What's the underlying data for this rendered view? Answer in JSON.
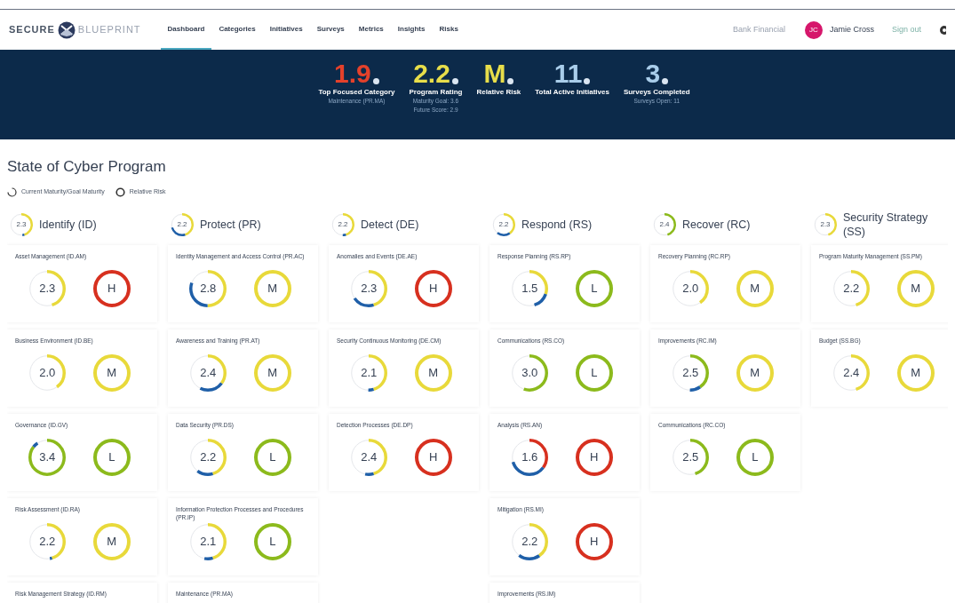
{
  "brand": {
    "left": "SECURE",
    "right": "BLUEPRINT"
  },
  "nav": [
    {
      "label": "Dashboard",
      "selected": true
    },
    {
      "label": "Categories",
      "selected": false
    },
    {
      "label": "Initiatives",
      "selected": false
    },
    {
      "label": "Surveys",
      "selected": false
    },
    {
      "label": "Metrics",
      "selected": false
    },
    {
      "label": "Insights",
      "selected": false
    },
    {
      "label": "Risks",
      "selected": false
    }
  ],
  "user": {
    "organization": "Bank Financial",
    "initials": "JC",
    "name": "Jamie Cross",
    "sign_out": "Sign out"
  },
  "stats": [
    {
      "value": "1.9",
      "color": "#e4412b",
      "label": "Top Focused Category",
      "notes": [
        "Maintenance (PR.MA)"
      ]
    },
    {
      "value": "2.2",
      "color": "#e8de4a",
      "label": "Program Rating",
      "notes": [
        "Maturity Goal: 3.6",
        "Future Score: 2.9"
      ]
    },
    {
      "value": "M",
      "color": "#e8de4a",
      "label": "Relative Risk"
    },
    {
      "value": "11",
      "color": "#a9cdea",
      "label": "Total Active Initiatives"
    },
    {
      "value": "3",
      "color": "#a9cdea",
      "label": "Surveys Completed",
      "notes": [
        "Surveys Open: 11"
      ]
    }
  ],
  "title": "State of Cyber Program",
  "legend": [
    "Current Maturity/Goal Maturity",
    "Relative Risk"
  ],
  "columns": [
    {
      "title": "Identify (ID)",
      "maturity": {
        "score": "2.3",
        "color": "#e8d93a",
        "level": 0.45,
        "future": {
          "level": 0.03
        }
      },
      "cards": [
        {
          "title": "Asset Management (ID.AM)",
          "maturity": {
            "score": "2.3",
            "color": "#e8d93a",
            "level": 0.45
          },
          "risk": {
            "label": "H",
            "color": "#d7301f"
          }
        },
        {
          "title": "Business Environment (ID.BE)",
          "maturity": {
            "score": "2.0",
            "color": "#e8d93a",
            "level": 0.4
          },
          "risk": {
            "label": "M",
            "color": "#e8d93a"
          }
        },
        {
          "title": "Governance (ID.GV)",
          "maturity": {
            "score": "3.4",
            "color": "#8cba1c",
            "level": 0.85,
            "future": {
              "level": 0.05
            }
          },
          "risk": {
            "label": "L",
            "color": "#8cba1c"
          }
        },
        {
          "title": "Risk Assessment (ID.RA)",
          "maturity": {
            "score": "2.2",
            "color": "#e8d93a",
            "level": 0.45,
            "future": {
              "level": 0.02
            }
          },
          "risk": {
            "label": "M",
            "color": "#e8d93a"
          }
        },
        {
          "title": "Risk Management Strategy (ID.RM)"
        }
      ]
    },
    {
      "title": "Protect (PR)",
      "maturity": {
        "score": "2.2",
        "color": "#e8d93a",
        "level": 0.45,
        "future": {
          "level": 0.25
        }
      },
      "cards": [
        {
          "title": "Identity Management and Access Control (PR.AC)",
          "maturity": {
            "score": "2.8",
            "color": "#e8d93a",
            "level": 0.5,
            "future": {
              "level": 0.3
            }
          },
          "risk": {
            "label": "M",
            "color": "#e8d93a"
          }
        },
        {
          "title": "Awareness and Training (PR.AT)",
          "maturity": {
            "score": "2.4",
            "color": "#e8d93a",
            "level": 0.35,
            "future": {
              "level": 0.22
            }
          },
          "risk": {
            "label": "M",
            "color": "#e8d93a"
          }
        },
        {
          "title": "Data Security (PR.DS)",
          "maturity": {
            "score": "2.2",
            "color": "#e8d93a",
            "level": 0.45,
            "future": {
              "level": 0.15
            }
          },
          "risk": {
            "label": "L",
            "color": "#8cba1c"
          }
        },
        {
          "title": "Information Protection Processes and Procedures (PR.IP)",
          "maturity": {
            "score": "2.1",
            "color": "#e8d93a",
            "level": 0.45,
            "future": {
              "level": 0.08
            }
          },
          "risk": {
            "label": "L",
            "color": "#8cba1c"
          }
        },
        {
          "title": "Maintenance (PR.MA)"
        }
      ]
    },
    {
      "title": "Detect (DE)",
      "maturity": {
        "score": "2.2",
        "color": "#e8d93a",
        "level": 0.45,
        "future": {
          "level": 0.05
        }
      },
      "cards": [
        {
          "title": "Anomalies and Events (DE.AE)",
          "maturity": {
            "score": "2.3",
            "color": "#e8d93a",
            "level": 0.45,
            "future": {
              "level": 0.2
            }
          },
          "risk": {
            "label": "H",
            "color": "#d7301f"
          }
        },
        {
          "title": "Security Continuous Monitoring (DE.CM)",
          "maturity": {
            "score": "2.1",
            "color": "#e8d93a",
            "level": 0.45,
            "future": {
              "level": 0.05
            }
          },
          "risk": {
            "label": "M",
            "color": "#e8d93a"
          }
        },
        {
          "title": "Detection Processes (DE.DP)",
          "maturity": {
            "score": "2.4",
            "color": "#e8d93a",
            "level": 0.45,
            "future": {
              "level": 0.08
            }
          },
          "risk": {
            "label": "H",
            "color": "#d7301f"
          }
        }
      ]
    },
    {
      "title": "Respond (RS)",
      "maturity": {
        "score": "2.2",
        "color": "#e8d93a",
        "level": 0.4,
        "future": {
          "level": 0.2
        }
      },
      "cards": [
        {
          "title": "Response Planning (RS.RP)",
          "maturity": {
            "score": "1.5",
            "color": "#e8d93a",
            "level": 0.3,
            "future": {
              "level": 0.15
            }
          },
          "risk": {
            "label": "L",
            "color": "#8cba1c"
          }
        },
        {
          "title": "Communications (RS.CO)",
          "maturity": {
            "score": "3.0",
            "color": "#8cba1c",
            "level": 0.55
          },
          "risk": {
            "label": "L",
            "color": "#8cba1c"
          }
        },
        {
          "title": "Analysis (RS.AN)",
          "maturity": {
            "score": "1.6",
            "color": "#d7301f",
            "level": 0.35,
            "future": {
              "level": 0.35
            }
          },
          "risk": {
            "label": "H",
            "color": "#d7301f"
          }
        },
        {
          "title": "Mitigation (RS.MI)",
          "maturity": {
            "score": "2.2",
            "color": "#e8d93a",
            "level": 0.4,
            "future": {
              "level": 0.2
            }
          },
          "risk": {
            "label": "H",
            "color": "#d7301f"
          }
        },
        {
          "title": "Improvements (RS.IM)"
        }
      ]
    },
    {
      "title": "Recover (RC)",
      "maturity": {
        "score": "2.4",
        "color": "#8cba1c",
        "level": 0.45
      },
      "cards": [
        {
          "title": "Recovery Planning (RC.RP)",
          "maturity": {
            "score": "2.0",
            "color": "#e8d93a",
            "level": 0.4
          },
          "risk": {
            "label": "M",
            "color": "#e8d93a"
          }
        },
        {
          "title": "Improvements (RC.IM)",
          "maturity": {
            "score": "2.5",
            "color": "#8cba1c",
            "level": 0.4,
            "future": {
              "level": 0.1
            }
          },
          "risk": {
            "label": "M",
            "color": "#e8d93a"
          }
        },
        {
          "title": "Communications (RC.CO)",
          "maturity": {
            "score": "2.5",
            "color": "#8cba1c",
            "level": 0.45
          },
          "risk": {
            "label": "L",
            "color": "#8cba1c"
          }
        }
      ]
    },
    {
      "title": "Security Strategy (SS)",
      "maturity": {
        "score": "2.3",
        "color": "#e8d93a",
        "level": 0.45
      },
      "cards": [
        {
          "title": "Program Maturity Management (SS.PM)",
          "maturity": {
            "score": "2.2",
            "color": "#e8d93a",
            "level": 0.45
          },
          "risk": {
            "label": "M",
            "color": "#e8d93a"
          }
        },
        {
          "title": "Budget (SS.BG)",
          "maturity": {
            "score": "2.4",
            "color": "#e8d93a",
            "level": 0.45
          },
          "risk": {
            "label": "M",
            "color": "#e8d93a"
          }
        }
      ]
    }
  ]
}
